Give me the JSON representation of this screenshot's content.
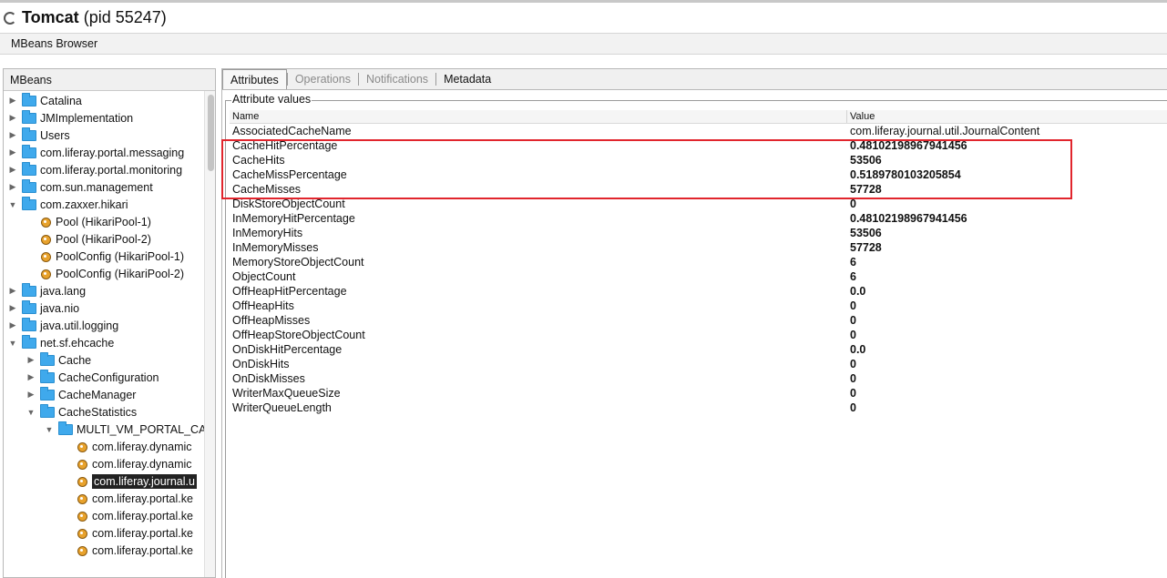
{
  "window": {
    "app_name": "Tomcat",
    "pid_text": "(pid 55247)"
  },
  "subtab": {
    "label": "MBeans Browser"
  },
  "left_panel": {
    "header": "MBeans",
    "tree": [
      {
        "label": "Catalina",
        "type": "folder",
        "depth": 0,
        "expanded": false
      },
      {
        "label": "JMImplementation",
        "type": "folder",
        "depth": 0,
        "expanded": false
      },
      {
        "label": "Users",
        "type": "folder",
        "depth": 0,
        "expanded": false
      },
      {
        "label": "com.liferay.portal.messaging",
        "type": "folder",
        "depth": 0,
        "expanded": false
      },
      {
        "label": "com.liferay.portal.monitoring",
        "type": "folder",
        "depth": 0,
        "expanded": false
      },
      {
        "label": "com.sun.management",
        "type": "folder",
        "depth": 0,
        "expanded": false
      },
      {
        "label": "com.zaxxer.hikari",
        "type": "folder",
        "depth": 0,
        "expanded": true
      },
      {
        "label": "Pool (HikariPool-1)",
        "type": "bean",
        "depth": 1
      },
      {
        "label": "Pool (HikariPool-2)",
        "type": "bean",
        "depth": 1
      },
      {
        "label": "PoolConfig (HikariPool-1)",
        "type": "bean",
        "depth": 1
      },
      {
        "label": "PoolConfig (HikariPool-2)",
        "type": "bean",
        "depth": 1
      },
      {
        "label": "java.lang",
        "type": "folder",
        "depth": 0,
        "expanded": false
      },
      {
        "label": "java.nio",
        "type": "folder",
        "depth": 0,
        "expanded": false
      },
      {
        "label": "java.util.logging",
        "type": "folder",
        "depth": 0,
        "expanded": false
      },
      {
        "label": "net.sf.ehcache",
        "type": "folder",
        "depth": 0,
        "expanded": true
      },
      {
        "label": "Cache",
        "type": "folder",
        "depth": 1,
        "expanded": false
      },
      {
        "label": "CacheConfiguration",
        "type": "folder",
        "depth": 1,
        "expanded": false
      },
      {
        "label": "CacheManager",
        "type": "folder",
        "depth": 1,
        "expanded": false
      },
      {
        "label": "CacheStatistics",
        "type": "folder",
        "depth": 1,
        "expanded": true
      },
      {
        "label": "MULTI_VM_PORTAL_CAC",
        "type": "folder",
        "depth": 2,
        "expanded": true
      },
      {
        "label": "com.liferay.dynamic",
        "type": "bean",
        "depth": 3
      },
      {
        "label": "com.liferay.dynamic",
        "type": "bean",
        "depth": 3
      },
      {
        "label": "com.liferay.journal.u",
        "type": "bean",
        "depth": 3,
        "selected": true
      },
      {
        "label": "com.liferay.portal.ke",
        "type": "bean",
        "depth": 3
      },
      {
        "label": "com.liferay.portal.ke",
        "type": "bean",
        "depth": 3
      },
      {
        "label": "com.liferay.portal.ke",
        "type": "bean",
        "depth": 3
      },
      {
        "label": "com.liferay.portal.ke",
        "type": "bean",
        "depth": 3
      }
    ]
  },
  "tabs": [
    {
      "label": "Attributes",
      "state": "active"
    },
    {
      "label": "Operations",
      "state": "disabled"
    },
    {
      "label": "Notifications",
      "state": "disabled"
    },
    {
      "label": "Metadata",
      "state": "normal"
    }
  ],
  "attributes": {
    "section_title": "Attribute values",
    "columns": {
      "name": "Name",
      "value": "Value"
    },
    "rows": [
      {
        "name": "AssociatedCacheName",
        "value": "com.liferay.journal.util.JournalContent",
        "bold": false
      },
      {
        "name": "CacheHitPercentage",
        "value": "0.48102198967941456",
        "bold": true
      },
      {
        "name": "CacheHits",
        "value": "53506",
        "bold": true
      },
      {
        "name": "CacheMissPercentage",
        "value": "0.5189780103205854",
        "bold": true
      },
      {
        "name": "CacheMisses",
        "value": "57728",
        "bold": true
      },
      {
        "name": "DiskStoreObjectCount",
        "value": "0",
        "bold": true
      },
      {
        "name": "InMemoryHitPercentage",
        "value": "0.48102198967941456",
        "bold": true
      },
      {
        "name": "InMemoryHits",
        "value": "53506",
        "bold": true
      },
      {
        "name": "InMemoryMisses",
        "value": "57728",
        "bold": true
      },
      {
        "name": "MemoryStoreObjectCount",
        "value": "6",
        "bold": true
      },
      {
        "name": "ObjectCount",
        "value": "6",
        "bold": true
      },
      {
        "name": "OffHeapHitPercentage",
        "value": "0.0",
        "bold": true
      },
      {
        "name": "OffHeapHits",
        "value": "0",
        "bold": true
      },
      {
        "name": "OffHeapMisses",
        "value": "0",
        "bold": true
      },
      {
        "name": "OffHeapStoreObjectCount",
        "value": "0",
        "bold": true
      },
      {
        "name": "OnDiskHitPercentage",
        "value": "0.0",
        "bold": true
      },
      {
        "name": "OnDiskHits",
        "value": "0",
        "bold": true
      },
      {
        "name": "OnDiskMisses",
        "value": "0",
        "bold": true
      },
      {
        "name": "WriterMaxQueueSize",
        "value": "0",
        "bold": true
      },
      {
        "name": "WriterQueueLength",
        "value": "0",
        "bold": true
      }
    ]
  },
  "colors": {
    "highlight_border": "#e1252d",
    "selection_bg": "#222222",
    "folder": "#3fa9ec"
  }
}
